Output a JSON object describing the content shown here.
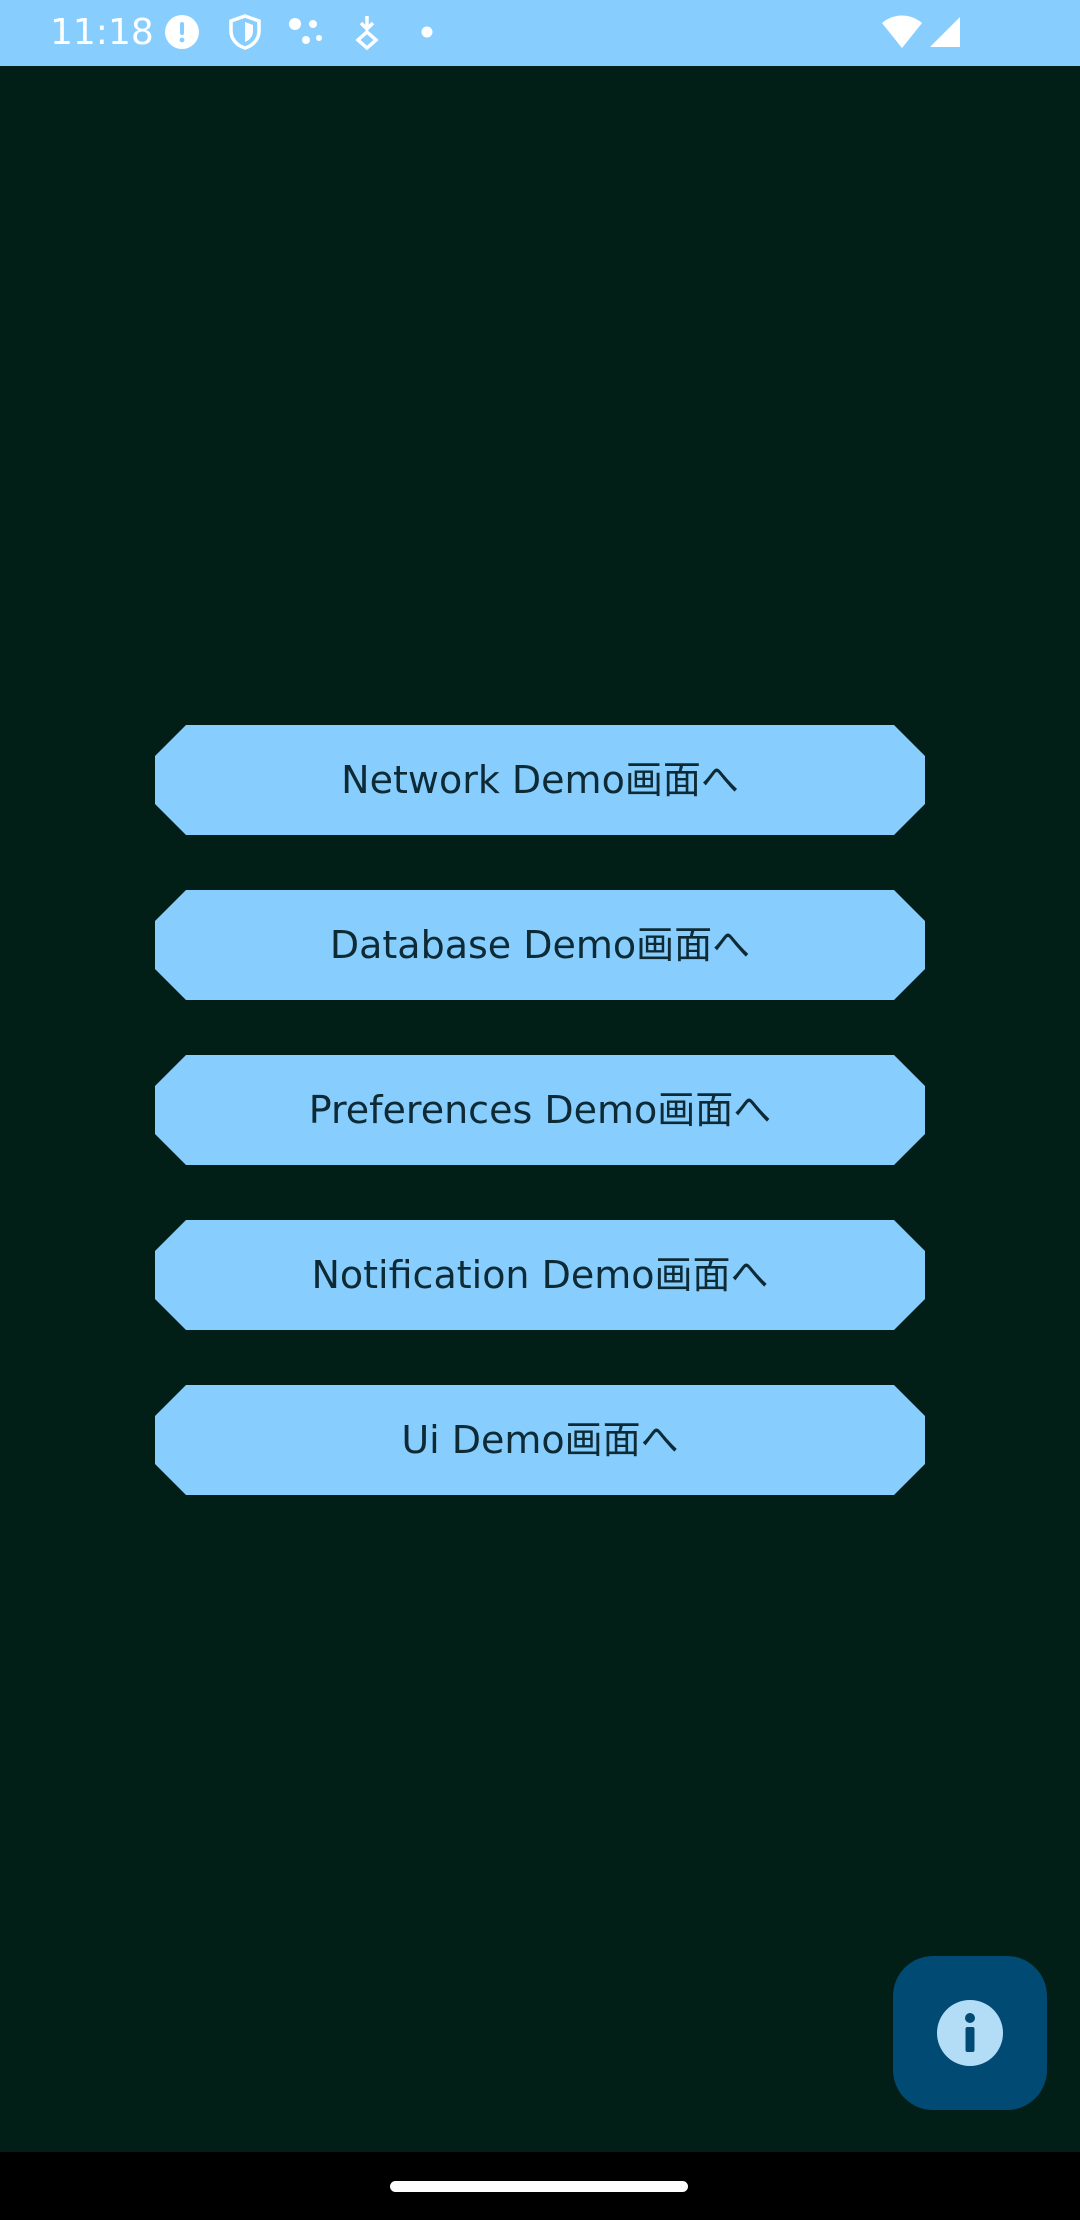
{
  "status_bar": {
    "time": "11:18",
    "background": "#87ceff",
    "icons": [
      "alert-icon",
      "shield-icon",
      "dots-icon",
      "download-icon",
      "dot-icon",
      "wifi-icon",
      "signal-icon"
    ]
  },
  "main": {
    "background": "#021f17",
    "buttons": [
      {
        "label": "Network Demo画面へ"
      },
      {
        "label": "Database Demo画面へ"
      },
      {
        "label": "Preferences Demo画面へ"
      },
      {
        "label": "Notification Demo画面へ"
      },
      {
        "label": "Ui Demo画面へ"
      }
    ],
    "button_color": "#87ceff"
  },
  "fab": {
    "icon": "info-icon",
    "color": "#004a74"
  }
}
